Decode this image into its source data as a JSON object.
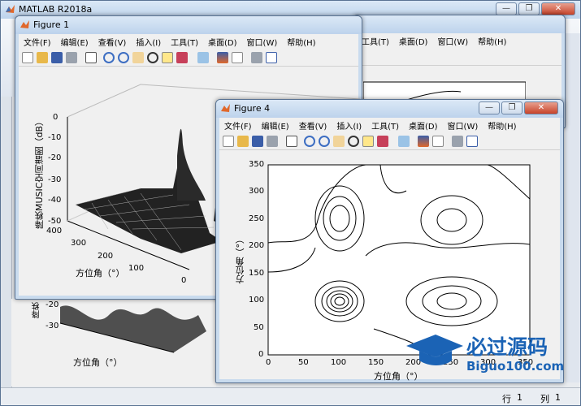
{
  "main_window": {
    "title": "MATLAB R2018a"
  },
  "menu": [
    "文件(F)",
    "编辑(E)",
    "查看(V)",
    "插入(I)",
    "工具(T)",
    "桌面(D)",
    "窗口(W)",
    "帮助(H)"
  ],
  "back_menu": [
    "工具(T)",
    "桌面(D)",
    "窗口(W)",
    "帮助(H)"
  ],
  "fig1": {
    "title": "Figure 1",
    "zlabel": "降秩MUSIC空间谱图（dB）",
    "zticks": [
      "0",
      "-10",
      "-20",
      "-30",
      "-40",
      "-50"
    ],
    "yticks": [
      "400",
      "300",
      "200",
      "100",
      "0"
    ],
    "xlabel": "方位角（°）"
  },
  "fig4": {
    "title": "Figure 4",
    "ylabel": "方位角（°）",
    "xlabel": "方位角（°）",
    "yticks": [
      "350",
      "300",
      "250",
      "200",
      "150",
      "100",
      "50",
      "0"
    ],
    "xticks": [
      "0",
      "50",
      "100",
      "150",
      "200",
      "250",
      "300",
      "350"
    ]
  },
  "back_plot": {
    "zticks": [
      "-20",
      "-30"
    ],
    "zlabel": "降秩",
    "xlabel": "方位角（°）"
  },
  "status": {
    "row_label": "行",
    "row_value": "1",
    "col_label": "列",
    "col_value": "1"
  },
  "watermark": {
    "text1": "必过源码",
    "text2": "Biguo100.com"
  },
  "colors": {
    "titlebar": "#c9dbee",
    "plot_bg": "#ffffff",
    "watermark": "#1b63b5"
  }
}
